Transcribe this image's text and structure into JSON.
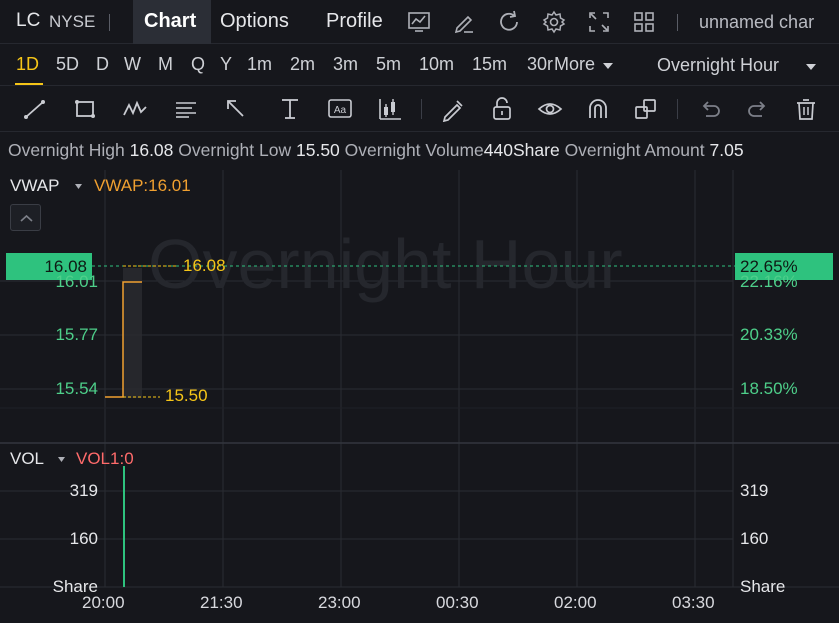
{
  "header": {
    "ticker": "LC",
    "exchange": "NYSE",
    "tabs": [
      {
        "label": "Chart",
        "active": true
      },
      {
        "label": "Options",
        "active": false
      },
      {
        "label": "Profile",
        "active": false
      }
    ],
    "icons": [
      "chart-settings-icon",
      "draw-icon",
      "refresh-icon",
      "gear-icon",
      "fullscreen-icon",
      "layout-grid-icon"
    ],
    "layout_name": "unnamed char"
  },
  "timeframes": {
    "items": [
      "1D",
      "5D",
      "D",
      "W",
      "M",
      "Q",
      "Y",
      "1m",
      "2m",
      "3m",
      "5m",
      "10m",
      "15m",
      "30r"
    ],
    "active": "1D",
    "more_label": "More",
    "session_label": "Overnight Hour"
  },
  "tools": [
    "line-tool-icon",
    "rectangle-tool-icon",
    "wave-tool-icon",
    "fibonacci-tool-icon",
    "arrow-tool-icon",
    "measure-tool-icon",
    "text-tool-icon",
    "pattern-tool-icon",
    "pencil-icon",
    "lock-icon",
    "eye-icon",
    "magnet-icon",
    "layers-icon",
    "undo-icon",
    "redo-icon",
    "trash-icon"
  ],
  "info": {
    "high_label": "Overnight High",
    "high_value": "16.08",
    "low_label": "Overnight Low",
    "low_value": "15.50",
    "volume_label": "Overnight Volume",
    "volume_value": "440Share",
    "amount_label": "Overnight Amount",
    "amount_value": "7.05"
  },
  "price_panel": {
    "label": "VWAP",
    "indicator": "VWAP:16.01",
    "watermark": "Overnight Hour",
    "current_price": "16.08",
    "current_pct": "22.65%",
    "left_ticks": [
      "16.01",
      "15.77",
      "15.54"
    ],
    "right_ticks": [
      "22.16%",
      "20.33%",
      "18.50%"
    ],
    "high_marker": "16.08",
    "low_marker": "15.50"
  },
  "volume_panel": {
    "label": "VOL",
    "indicator": "VOL1:0",
    "left_ticks": [
      "319",
      "160",
      "Share"
    ],
    "right_ticks": [
      "319",
      "160",
      "Share"
    ]
  },
  "x_axis": [
    "20:00",
    "21:30",
    "23:00",
    "00:30",
    "02:00",
    "03:30"
  ],
  "colors": {
    "background": "#16171c",
    "up": "#2ec27e",
    "accent": "#f5c518",
    "vwap": "#f0a030",
    "vol_indicator": "#ff6b6b"
  }
}
